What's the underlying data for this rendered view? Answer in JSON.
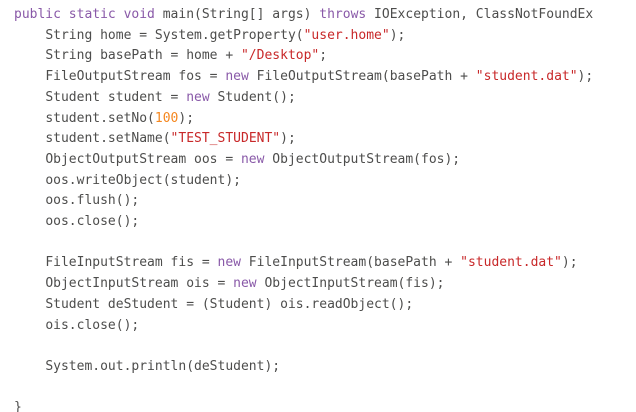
{
  "editor": {
    "language": "java",
    "colors": {
      "background": "#ffffff",
      "text": "#4d4d4c",
      "keyword": "#8959a8",
      "string": "#c82829",
      "number": "#f5871f"
    },
    "lines": [
      {
        "indent": "",
        "tokens": [
          {
            "t": "public static void ",
            "k": "kw"
          },
          {
            "t": "main(String[] args) ",
            "k": "plain"
          },
          {
            "t": "throws",
            "k": "kw"
          },
          {
            "t": " IOException, ClassNotFoundEx",
            "k": "plain"
          }
        ]
      },
      {
        "indent": "    ",
        "tokens": [
          {
            "t": "String home = System.getProperty(",
            "k": "plain"
          },
          {
            "t": "\"user.home\"",
            "k": "str"
          },
          {
            "t": ");",
            "k": "plain"
          }
        ]
      },
      {
        "indent": "    ",
        "tokens": [
          {
            "t": "String basePath = home + ",
            "k": "plain"
          },
          {
            "t": "\"/Desktop\"",
            "k": "str"
          },
          {
            "t": ";",
            "k": "plain"
          }
        ]
      },
      {
        "indent": "    ",
        "tokens": [
          {
            "t": "FileOutputStream fos = ",
            "k": "plain"
          },
          {
            "t": "new",
            "k": "kw"
          },
          {
            "t": " FileOutputStream(basePath + ",
            "k": "plain"
          },
          {
            "t": "\"student.dat\"",
            "k": "str"
          },
          {
            "t": ");",
            "k": "plain"
          }
        ]
      },
      {
        "indent": "    ",
        "tokens": [
          {
            "t": "Student student = ",
            "k": "plain"
          },
          {
            "t": "new",
            "k": "kw"
          },
          {
            "t": " Student();",
            "k": "plain"
          }
        ]
      },
      {
        "indent": "    ",
        "tokens": [
          {
            "t": "student.setNo(",
            "k": "plain"
          },
          {
            "t": "100",
            "k": "num"
          },
          {
            "t": ");",
            "k": "plain"
          }
        ]
      },
      {
        "indent": "    ",
        "tokens": [
          {
            "t": "student.setName(",
            "k": "plain"
          },
          {
            "t": "\"TEST_STUDENT\"",
            "k": "str"
          },
          {
            "t": ");",
            "k": "plain"
          }
        ]
      },
      {
        "indent": "    ",
        "tokens": [
          {
            "t": "ObjectOutputStream oos = ",
            "k": "plain"
          },
          {
            "t": "new",
            "k": "kw"
          },
          {
            "t": " ObjectOutputStream(fos);",
            "k": "plain"
          }
        ]
      },
      {
        "indent": "    ",
        "tokens": [
          {
            "t": "oos.writeObject(student);",
            "k": "plain"
          }
        ]
      },
      {
        "indent": "    ",
        "tokens": [
          {
            "t": "oos.flush();",
            "k": "plain"
          }
        ]
      },
      {
        "indent": "    ",
        "tokens": [
          {
            "t": "oos.close();",
            "k": "plain"
          }
        ]
      },
      {
        "indent": "",
        "tokens": []
      },
      {
        "indent": "    ",
        "tokens": [
          {
            "t": "FileInputStream fis = ",
            "k": "plain"
          },
          {
            "t": "new",
            "k": "kw"
          },
          {
            "t": " FileInputStream(basePath + ",
            "k": "plain"
          },
          {
            "t": "\"student.dat\"",
            "k": "str"
          },
          {
            "t": ");",
            "k": "plain"
          }
        ]
      },
      {
        "indent": "    ",
        "tokens": [
          {
            "t": "ObjectInputStream ois = ",
            "k": "plain"
          },
          {
            "t": "new",
            "k": "kw"
          },
          {
            "t": " ObjectInputStream(fis);",
            "k": "plain"
          }
        ]
      },
      {
        "indent": "    ",
        "tokens": [
          {
            "t": "Student deStudent = (Student) ois.readObject();",
            "k": "plain"
          }
        ]
      },
      {
        "indent": "    ",
        "tokens": [
          {
            "t": "ois.close();",
            "k": "plain"
          }
        ]
      },
      {
        "indent": "",
        "tokens": []
      },
      {
        "indent": "    ",
        "tokens": [
          {
            "t": "System.out.println(deStudent);",
            "k": "plain"
          }
        ]
      },
      {
        "indent": "",
        "tokens": []
      },
      {
        "indent": "",
        "tokens": [
          {
            "t": "}",
            "k": "plain"
          }
        ]
      }
    ]
  }
}
